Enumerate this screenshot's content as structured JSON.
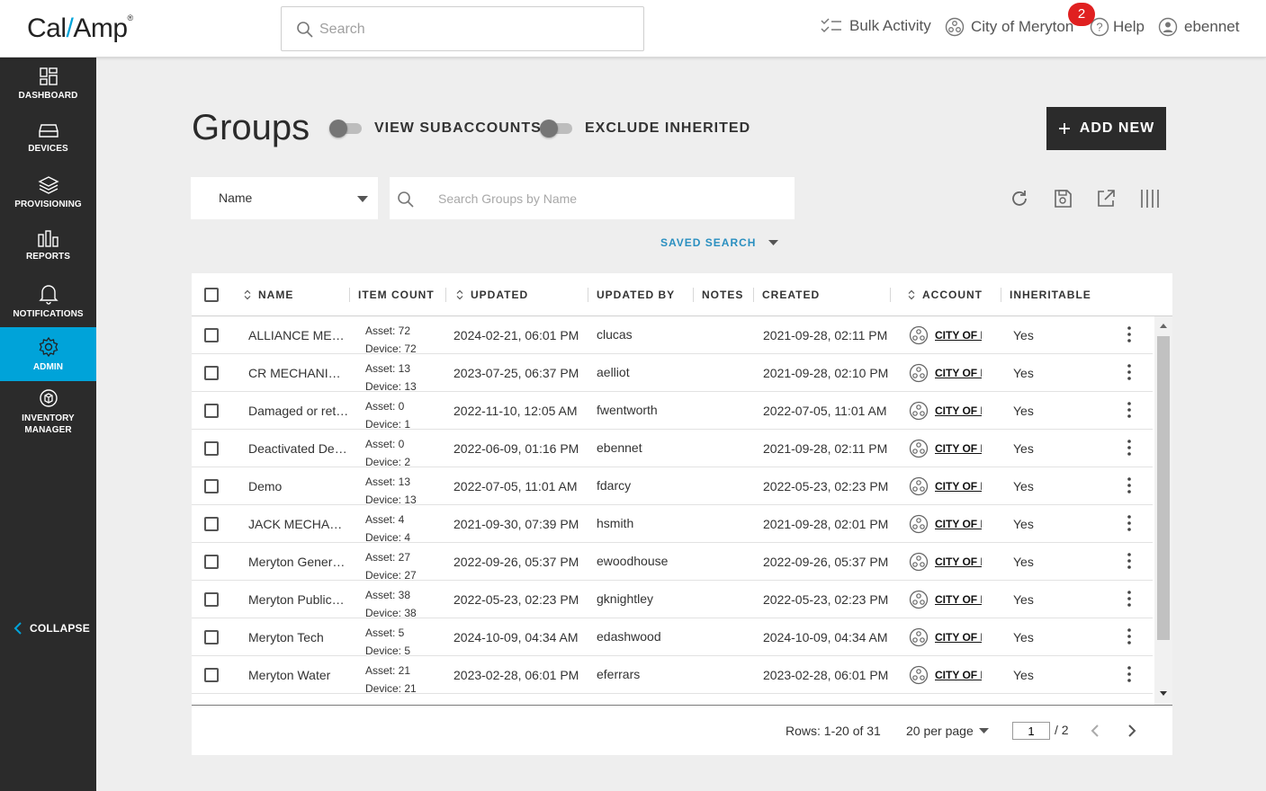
{
  "topbar": {
    "logo_left": "Cal",
    "logo_slash": "/",
    "logo_right": "Amp",
    "logo_mark": "®",
    "search_placeholder": "Search",
    "bulk_activity": "Bulk Activity",
    "account": "City of Meryton",
    "notification_count": "2",
    "help": "Help",
    "user": "ebennet"
  },
  "sidebar": {
    "items": [
      {
        "label": "DASHBOARD",
        "icon": "dashboard-icon"
      },
      {
        "label": "DEVICES",
        "icon": "devices-icon"
      },
      {
        "label": "PROVISIONING",
        "icon": "layers-icon"
      },
      {
        "label": "REPORTS",
        "icon": "bar-chart-icon"
      },
      {
        "label": "NOTIFICATIONS",
        "icon": "bell-icon"
      },
      {
        "label": "ADMIN",
        "icon": "gear-icon",
        "active": true
      },
      {
        "label": "INVENTORY",
        "label2": "MANAGER",
        "icon": "inventory-icon"
      }
    ],
    "collapse": "COLLAPSE"
  },
  "header": {
    "title": "Groups",
    "toggle1": "VIEW SUBACCOUNTS",
    "toggle2": "EXCLUDE INHERITED",
    "add_new": "ADD NEW"
  },
  "filter": {
    "field": "Name",
    "search_placeholder": "Search Groups by Name",
    "saved_search": "SAVED SEARCH"
  },
  "table": {
    "columns": {
      "name": "NAME",
      "item_count": "ITEM COUNT",
      "updated": "UPDATED",
      "updated_by": "UPDATED BY",
      "notes": "NOTES",
      "created": "CREATED",
      "account": "ACCOUNT",
      "inheritable": "INHERITABLE"
    },
    "rows": [
      {
        "name": "ALLIANCE MEC…",
        "asset": "Asset: 72",
        "device": "Device: 72",
        "updated": "2024-02-21, 06:01 PM",
        "by": "clucas",
        "created": "2021-09-28, 02:11 PM",
        "account": "CITY OF MERYTON",
        "inheritable": "Yes"
      },
      {
        "name": "CR MECHANIC…",
        "asset": "Asset: 13",
        "device": "Device: 13",
        "updated": "2023-07-25, 06:37 PM",
        "by": "aelliot",
        "created": "2021-09-28, 02:10 PM",
        "account": "CITY OF MERYTON",
        "inheritable": "Yes"
      },
      {
        "name": "Damaged or ret…",
        "asset": "Asset: 0",
        "device": "Device: 1",
        "updated": "2022-11-10, 12:05 AM",
        "by": "fwentworth",
        "created": "2022-07-05, 11:01 AM",
        "account": "CITY OF MERYTON",
        "inheritable": "Yes"
      },
      {
        "name": "Deactivated Dev…",
        "asset": "Asset: 0",
        "device": "Device: 2",
        "updated": "2022-06-09, 01:16 PM",
        "by": "ebennet",
        "created": "2021-09-28, 02:11 PM",
        "account": "CITY OF MERYTON",
        "inheritable": "Yes"
      },
      {
        "name": "Demo",
        "asset": "Asset: 13",
        "device": "Device: 13",
        "updated": "2022-07-05, 11:01 AM",
        "by": "fdarcy",
        "created": "2022-05-23, 02:23 PM",
        "account": "CITY OF MERYTON",
        "inheritable": "Yes"
      },
      {
        "name": "JACK MECHA…",
        "asset": "Asset: 4",
        "device": "Device: 4",
        "updated": "2021-09-30, 07:39 PM",
        "by": "hsmith",
        "created": "2021-09-28, 02:01 PM",
        "account": "CITY OF MERYTON",
        "inheritable": "Yes"
      },
      {
        "name": "Meryton Gener…",
        "asset": "Asset: 27",
        "device": "Device: 27",
        "updated": "2022-09-26, 05:37 PM",
        "by": "ewoodhouse",
        "created": "2022-09-26, 05:37 PM",
        "account": "CITY OF MERYTON",
        "inheritable": "Yes"
      },
      {
        "name": "Meryton Public…",
        "asset": "Asset: 38",
        "device": "Device: 38",
        "updated": "2022-05-23, 02:23 PM",
        "by": "gknightley",
        "created": "2022-05-23, 02:23 PM",
        "account": "CITY OF MERYTON",
        "inheritable": "Yes"
      },
      {
        "name": "Meryton Tech",
        "asset": "Asset: 5",
        "device": "Device: 5",
        "updated": "2024-10-09, 04:34 AM",
        "by": "edashwood",
        "created": "2024-10-09, 04:34 AM",
        "account": "CITY OF MERYTON",
        "inheritable": "Yes"
      },
      {
        "name": "Meryton Water",
        "asset": "Asset: 21",
        "device": "Device: 21",
        "updated": "2023-02-28, 06:01 PM",
        "by": "eferrars",
        "created": "2023-02-28, 06:01 PM",
        "account": "CITY OF MERYTON",
        "inheritable": "Yes"
      }
    ]
  },
  "footer": {
    "rows_info": "Rows: 1-20 of 31",
    "per_page": "20 per page",
    "page": "1",
    "total_pages": "/ 2"
  },
  "colors": {
    "accent": "#00a3d9",
    "sidebar": "#2b2b2b",
    "badge": "#e02020",
    "link": "#2a8fc0"
  }
}
